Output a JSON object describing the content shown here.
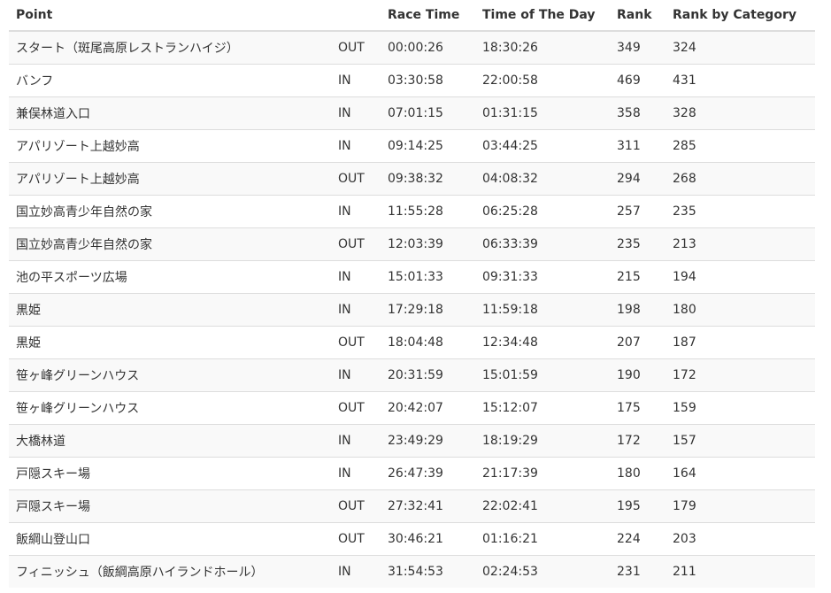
{
  "table": {
    "headers": {
      "point": "Point",
      "direction": "",
      "race_time": "Race Time",
      "time_of_day": "Time of The Day",
      "rank": "Rank",
      "rank_by_category": "Rank by Category"
    },
    "rows": [
      {
        "point": "スタート（斑尾高原レストランハイジ）",
        "direction": "OUT",
        "race_time": "00:00:26",
        "time_of_day": "18:30:26",
        "rank": "349",
        "rank_by_category": "324"
      },
      {
        "point": "バンフ",
        "direction": "IN",
        "race_time": "03:30:58",
        "time_of_day": "22:00:58",
        "rank": "469",
        "rank_by_category": "431"
      },
      {
        "point": "兼俣林道入口",
        "direction": "IN",
        "race_time": "07:01:15",
        "time_of_day": "01:31:15",
        "rank": "358",
        "rank_by_category": "328"
      },
      {
        "point": "アパリゾート上越妙高",
        "direction": "IN",
        "race_time": "09:14:25",
        "time_of_day": "03:44:25",
        "rank": "311",
        "rank_by_category": "285"
      },
      {
        "point": "アパリゾート上越妙高",
        "direction": "OUT",
        "race_time": "09:38:32",
        "time_of_day": "04:08:32",
        "rank": "294",
        "rank_by_category": "268"
      },
      {
        "point": "国立妙高青少年自然の家",
        "direction": "IN",
        "race_time": "11:55:28",
        "time_of_day": "06:25:28",
        "rank": "257",
        "rank_by_category": "235"
      },
      {
        "point": "国立妙高青少年自然の家",
        "direction": "OUT",
        "race_time": "12:03:39",
        "time_of_day": "06:33:39",
        "rank": "235",
        "rank_by_category": "213"
      },
      {
        "point": "池の平スポーツ広場",
        "direction": "IN",
        "race_time": "15:01:33",
        "time_of_day": "09:31:33",
        "rank": "215",
        "rank_by_category": "194"
      },
      {
        "point": "黒姫",
        "direction": "IN",
        "race_time": "17:29:18",
        "time_of_day": "11:59:18",
        "rank": "198",
        "rank_by_category": "180"
      },
      {
        "point": "黒姫",
        "direction": "OUT",
        "race_time": "18:04:48",
        "time_of_day": "12:34:48",
        "rank": "207",
        "rank_by_category": "187"
      },
      {
        "point": "笹ヶ峰グリーンハウス",
        "direction": "IN",
        "race_time": "20:31:59",
        "time_of_day": "15:01:59",
        "rank": "190",
        "rank_by_category": "172"
      },
      {
        "point": "笹ヶ峰グリーンハウス",
        "direction": "OUT",
        "race_time": "20:42:07",
        "time_of_day": "15:12:07",
        "rank": "175",
        "rank_by_category": "159"
      },
      {
        "point": "大橋林道",
        "direction": "IN",
        "race_time": "23:49:29",
        "time_of_day": "18:19:29",
        "rank": "172",
        "rank_by_category": "157"
      },
      {
        "point": "戸隠スキー場",
        "direction": "IN",
        "race_time": "26:47:39",
        "time_of_day": "21:17:39",
        "rank": "180",
        "rank_by_category": "164"
      },
      {
        "point": "戸隠スキー場",
        "direction": "OUT",
        "race_time": "27:32:41",
        "time_of_day": "22:02:41",
        "rank": "195",
        "rank_by_category": "179"
      },
      {
        "point": "飯綱山登山口",
        "direction": "OUT",
        "race_time": "30:46:21",
        "time_of_day": "01:16:21",
        "rank": "224",
        "rank_by_category": "203"
      },
      {
        "point": "フィニッシュ（飯綱高原ハイランドホール）",
        "direction": "IN",
        "race_time": "31:54:53",
        "time_of_day": "02:24:53",
        "rank": "231",
        "rank_by_category": "211"
      }
    ]
  }
}
